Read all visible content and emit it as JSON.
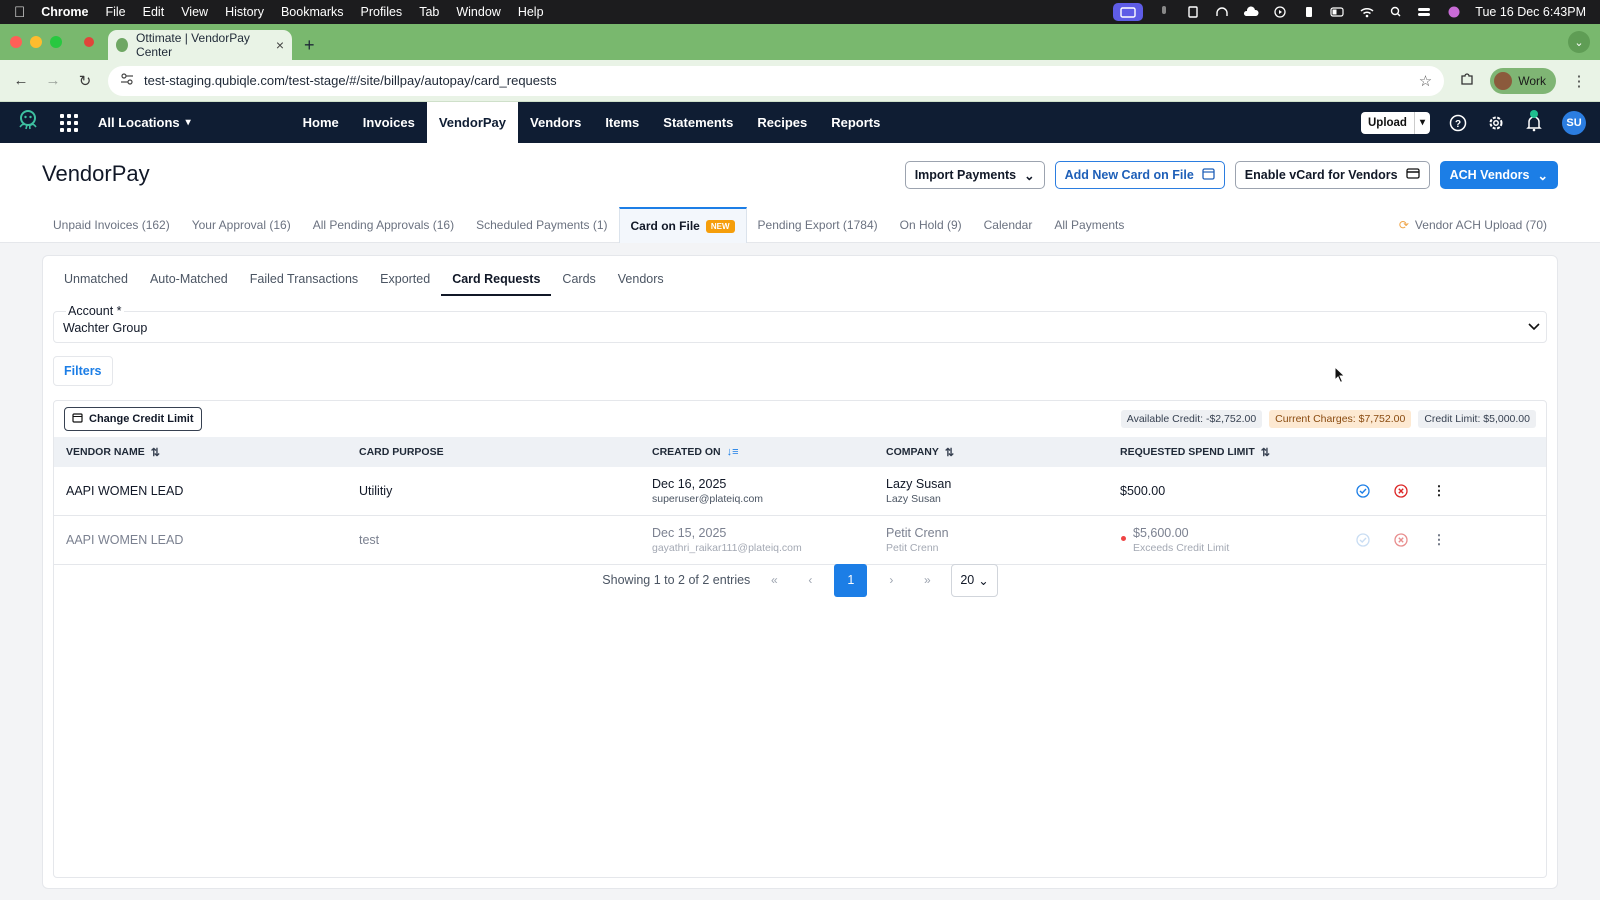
{
  "menubar": {
    "app": "Chrome",
    "items": [
      "File",
      "Edit",
      "View",
      "History",
      "Bookmarks",
      "Profiles",
      "Tab",
      "Window",
      "Help"
    ],
    "clock": "Tue 16 Dec  6:43PM"
  },
  "browser": {
    "tab_title": "Ottimate | VendorPay Center",
    "url": "test-staging.qubiqle.com/test-stage/#/site/billpay/autopay/card_requests",
    "profile": "Work"
  },
  "appnav": {
    "location": "All Locations",
    "links": [
      "Home",
      "Invoices",
      "VendorPay",
      "Vendors",
      "Items",
      "Statements",
      "Recipes",
      "Reports"
    ],
    "active_link": "VendorPay",
    "upload_label": "Upload",
    "avatar_initials": "SU"
  },
  "header": {
    "title": "VendorPay",
    "buttons": {
      "import": "Import Payments",
      "add_card": "Add New Card on File",
      "enable_vcard": "Enable vCard for Vendors",
      "ach": "ACH Vendors"
    },
    "tabs": [
      "Unpaid Invoices (162)",
      "Your Approval (16)",
      "All Pending Approvals (16)",
      "Scheduled Payments (1)",
      "Card on File",
      "Pending Export (1784)",
      "On Hold (9)",
      "Calendar",
      "All Payments"
    ],
    "new_badge": "NEW",
    "right_tab": "Vendor ACH Upload (70)"
  },
  "subtabs": [
    "Unmatched",
    "Auto-Matched",
    "Failed Transactions",
    "Exported",
    "Card Requests",
    "Cards",
    "Vendors"
  ],
  "account": {
    "label": "Account *",
    "value": "Wachter Group"
  },
  "filters_label": "Filters",
  "table": {
    "change_limit_label": "Change Credit Limit",
    "chips": {
      "available": "Available Credit: -$2,752.00",
      "current": "Current Charges: $7,752.00",
      "limit": "Credit Limit: $5,000.00"
    },
    "headers": {
      "vendor": "VENDOR NAME",
      "purpose": "CARD PURPOSE",
      "created": "CREATED ON",
      "company": "COMPANY",
      "limit": "REQUESTED SPEND LIMIT"
    },
    "rows": [
      {
        "vendor": "AAPI WOMEN LEAD",
        "purpose": "Utilitiy",
        "date": "Dec 16, 2025",
        "email": "superuser@plateiq.com",
        "company": "Lazy Susan",
        "company_sub": "Lazy Susan",
        "amount": "$500.00",
        "amount_note": ""
      },
      {
        "vendor": "AAPI WOMEN LEAD",
        "purpose": "test",
        "date": "Dec 15, 2025",
        "email": "gayathri_raikar111@plateiq.com",
        "company": "Petit Crenn",
        "company_sub": "Petit Crenn",
        "amount": "$5,600.00",
        "amount_note": "Exceeds Credit Limit"
      }
    ],
    "pagination": {
      "summary": "Showing 1 to 2 of 2 entries",
      "current_page": "1",
      "page_size": "20"
    }
  }
}
